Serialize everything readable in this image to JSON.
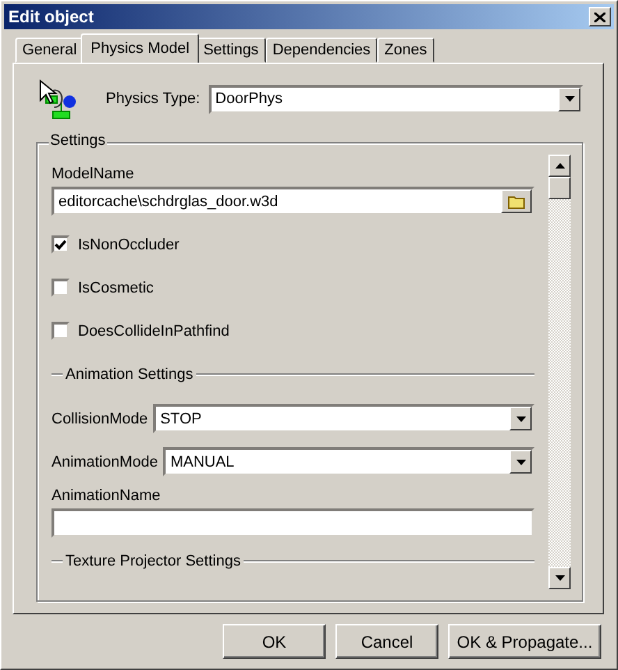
{
  "window": {
    "title": "Edit object"
  },
  "tabs": [
    {
      "label": "General",
      "selected": false
    },
    {
      "label": "Physics Model",
      "selected": true
    },
    {
      "label": "Settings",
      "selected": false
    },
    {
      "label": "Dependencies",
      "selected": false
    },
    {
      "label": "Zones",
      "selected": false
    }
  ],
  "physics_type": {
    "label": "Physics Type:",
    "value": "DoorPhys"
  },
  "settings": {
    "title": "Settings",
    "model_name": {
      "label": "ModelName",
      "value": "editorcache\\schdrglas_door.w3d"
    },
    "checkboxes": [
      {
        "label": "IsNonOccluder",
        "checked": true
      },
      {
        "label": "IsCosmetic",
        "checked": false
      },
      {
        "label": "DoesCollideInPathfind",
        "checked": false
      }
    ],
    "animation_settings": {
      "title": "Animation Settings",
      "collision_mode": {
        "label": "CollisionMode",
        "value": "STOP"
      },
      "animation_mode": {
        "label": "AnimationMode",
        "value": "MANUAL"
      },
      "animation_name": {
        "label": "AnimationName"
      }
    },
    "texture_projector_settings": {
      "title": "Texture Projector Settings"
    }
  },
  "buttons": [
    "OK",
    "Cancel",
    "OK & Propagate..."
  ]
}
